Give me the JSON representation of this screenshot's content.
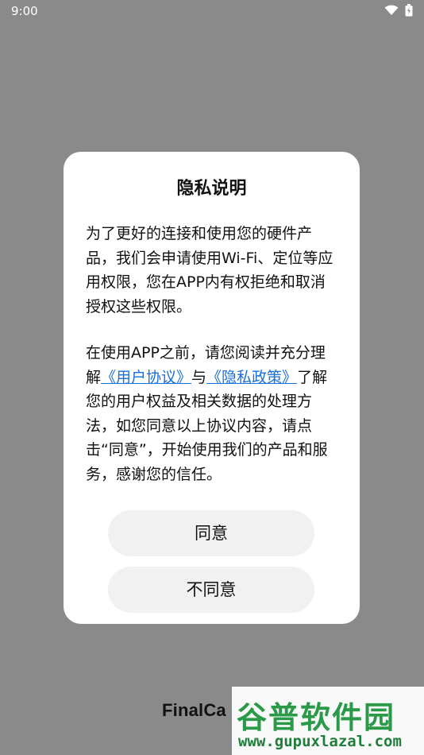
{
  "status_bar": {
    "time": "9:00",
    "icons": [
      "wifi-icon",
      "battery-icon"
    ]
  },
  "dialog": {
    "title": "隐私说明",
    "paragraph1": "为了更好的连接和使用您的硬件产品，我们会申请使用Wi-Fi、定位等应用权限，您在APP内有权拒绝和取消授权这些权限。",
    "paragraph2_prefix": "在使用APP之前，请您阅读并充分理解",
    "user_agreement_link": "《用户协议》",
    "connector": "与",
    "privacy_policy_link": "《隐私政策》",
    "paragraph2_suffix": "了解您的用户权益及相关数据的处理方法，如您同意以上协议内容，请点击“同意”，开始使用我们的产品和服务，感谢您的信任。",
    "agree_label": "同意",
    "disagree_label": "不同意",
    "link_color": "#1a6fd8"
  },
  "background": {
    "logo_text": "FinalCa"
  },
  "watermark": {
    "title": "谷普软件园",
    "url": "www.gupuxlazal.com",
    "color": "#2a9a49"
  }
}
